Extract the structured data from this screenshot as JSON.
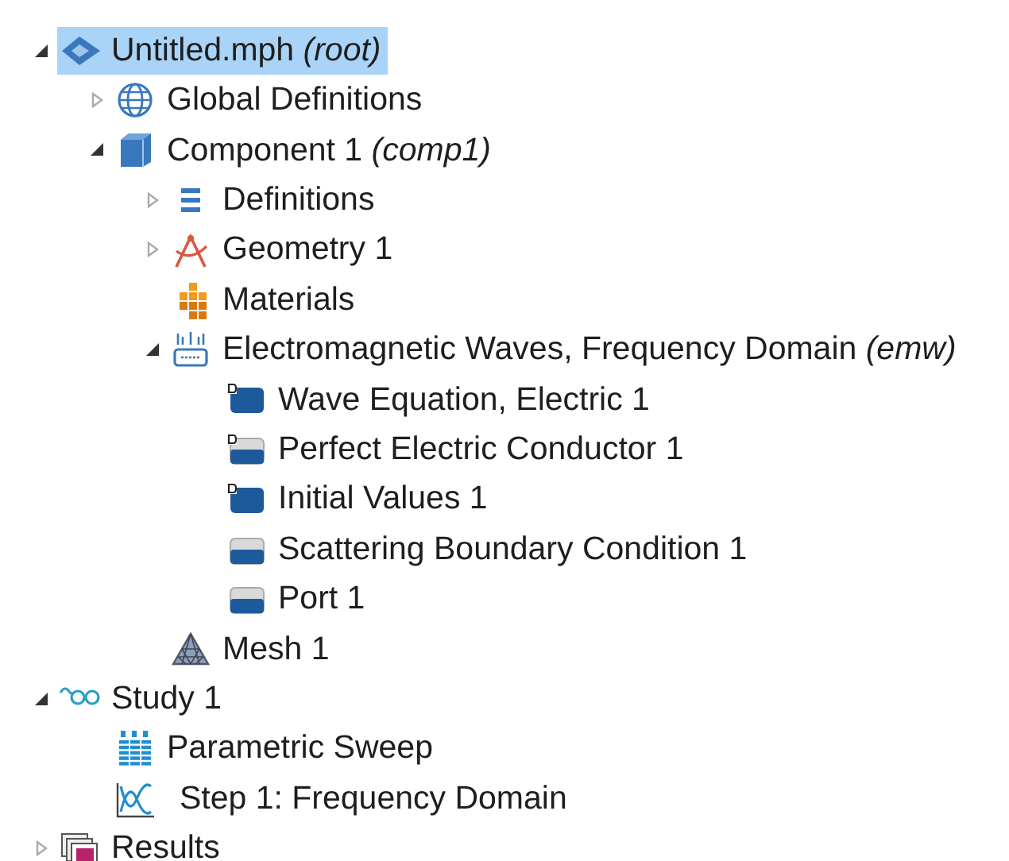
{
  "tree": [
    {
      "label": "Untitled.mph *(root)*",
      "kind": "root",
      "expanded": true,
      "selected": true,
      "children": [
        {
          "label": "Global Definitions",
          "kind": "global",
          "expanded": false,
          "selected": false
        },
        {
          "label": "Component 1 *(comp1)*",
          "kind": "component",
          "expanded": true,
          "selected": false,
          "children": [
            {
              "label": "Definitions",
              "kind": "definitions",
              "expanded": false,
              "selected": false
            },
            {
              "label": "Geometry 1",
              "kind": "geometry",
              "expanded": false,
              "selected": false
            },
            {
              "label": "Materials",
              "kind": "materials",
              "selected": false
            },
            {
              "label": "Electromagnetic Waves, Frequency Domain *(emw)*",
              "kind": "physics",
              "expanded": true,
              "selected": false,
              "children": [
                {
                  "label": "Wave Equation, Electric 1",
                  "kind": "domain-default",
                  "selected": false
                },
                {
                  "label": "Perfect Electric Conductor 1",
                  "kind": "boundary-default",
                  "selected": false
                },
                {
                  "label": "Initial Values 1",
                  "kind": "domain-default",
                  "selected": false
                },
                {
                  "label": "Scattering Boundary Condition 1",
                  "kind": "boundary",
                  "selected": false
                },
                {
                  "label": "Port 1",
                  "kind": "boundary",
                  "selected": false
                }
              ]
            },
            {
              "label": "Mesh 1",
              "kind": "mesh",
              "selected": false
            }
          ]
        }
      ]
    },
    {
      "label": "Study 1",
      "kind": "study",
      "expanded": true,
      "selected": false,
      "children": [
        {
          "label": "Parametric Sweep",
          "kind": "sweep",
          "selected": false
        },
        {
          "label": "Step 1: Frequency Domain",
          "kind": "step",
          "selected": false
        }
      ]
    },
    {
      "label": "Results",
      "kind": "results",
      "expanded": false,
      "selected": false
    }
  ]
}
